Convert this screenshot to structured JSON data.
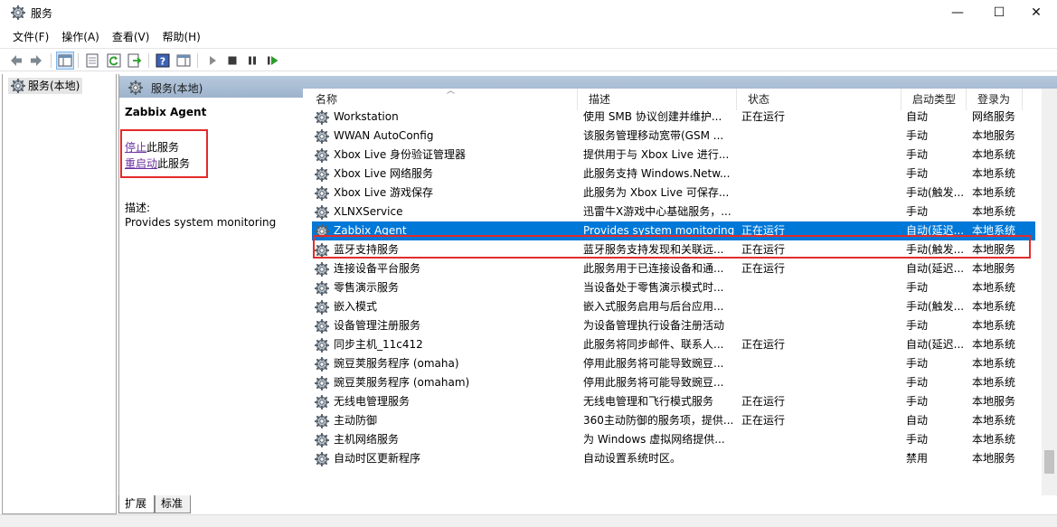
{
  "window": {
    "title": "服务",
    "minimize": "—",
    "maximize": "☐",
    "close": "✕"
  },
  "menu": [
    "文件(F)",
    "操作(A)",
    "查看(V)",
    "帮助(H)"
  ],
  "tree": {
    "root": "服务(本地)"
  },
  "pane": {
    "header": "服务(本地)"
  },
  "detail": {
    "service_name": "Zabbix Agent",
    "stop_link": "停止",
    "stop_suffix": "此服务",
    "restart_link": "重启动",
    "restart_suffix": "此服务",
    "desc_label": "描述:",
    "desc_text": "Provides system monitoring"
  },
  "columns": {
    "name": "名称",
    "desc": "描述",
    "status": "状态",
    "startup": "启动类型",
    "logon": "登录为"
  },
  "rows": [
    {
      "name": "Workstation",
      "desc": "使用 SMB 协议创建并维护...",
      "status": "正在运行",
      "startup": "自动",
      "logon": "网络服务"
    },
    {
      "name": "WWAN AutoConfig",
      "desc": "该服务管理移动宽带(GSM ...",
      "status": "",
      "startup": "手动",
      "logon": "本地服务"
    },
    {
      "name": "Xbox Live 身份验证管理器",
      "desc": "提供用于与 Xbox Live 进行...",
      "status": "",
      "startup": "手动",
      "logon": "本地系统"
    },
    {
      "name": "Xbox Live 网络服务",
      "desc": "此服务支持 Windows.Netw...",
      "status": "",
      "startup": "手动",
      "logon": "本地系统"
    },
    {
      "name": "Xbox Live 游戏保存",
      "desc": "此服务为 Xbox Live 可保存...",
      "status": "",
      "startup": "手动(触发...",
      "logon": "本地系统"
    },
    {
      "name": "XLNXService",
      "desc": "迅雷牛X游戏中心基础服务，...",
      "status": "",
      "startup": "手动",
      "logon": "本地系统"
    },
    {
      "name": "Zabbix Agent",
      "desc": "Provides system monitoring",
      "status": "正在运行",
      "startup": "自动(延迟...",
      "logon": "本地系统"
    },
    {
      "name": "蓝牙支持服务",
      "desc": "蓝牙服务支持发现和关联远...",
      "status": "正在运行",
      "startup": "手动(触发...",
      "logon": "本地服务"
    },
    {
      "name": "连接设备平台服务",
      "desc": "此服务用于已连接设备和通...",
      "status": "正在运行",
      "startup": "自动(延迟...",
      "logon": "本地服务"
    },
    {
      "name": "零售演示服务",
      "desc": "当设备处于零售演示模式时...",
      "status": "",
      "startup": "手动",
      "logon": "本地系统"
    },
    {
      "name": "嵌入模式",
      "desc": "嵌入式服务启用与后台应用...",
      "status": "",
      "startup": "手动(触发...",
      "logon": "本地系统"
    },
    {
      "name": "设备管理注册服务",
      "desc": "为设备管理执行设备注册活动",
      "status": "",
      "startup": "手动",
      "logon": "本地系统"
    },
    {
      "name": "同步主机_11c412",
      "desc": "此服务将同步邮件、联系人...",
      "status": "正在运行",
      "startup": "自动(延迟...",
      "logon": "本地系统"
    },
    {
      "name": "豌豆荚服务程序 (omaha)",
      "desc": "停用此服务将可能导致豌豆...",
      "status": "",
      "startup": "手动",
      "logon": "本地系统"
    },
    {
      "name": "豌豆荚服务程序 (omaham)",
      "desc": "停用此服务将可能导致豌豆...",
      "status": "",
      "startup": "手动",
      "logon": "本地系统"
    },
    {
      "name": "无线电管理服务",
      "desc": "无线电管理和飞行模式服务",
      "status": "正在运行",
      "startup": "手动",
      "logon": "本地服务"
    },
    {
      "name": "主动防御",
      "desc": "360主动防御的服务项，提供...",
      "status": "正在运行",
      "startup": "自动",
      "logon": "本地系统"
    },
    {
      "name": "主机网络服务",
      "desc": "为 Windows 虚拟网络提供...",
      "status": "",
      "startup": "手动",
      "logon": "本地系统"
    },
    {
      "name": "自动时区更新程序",
      "desc": "自动设置系统时区。",
      "status": "",
      "startup": "禁用",
      "logon": "本地服务"
    }
  ],
  "selected_row": 6,
  "tabs": [
    "扩展",
    "标准"
  ],
  "colors": {
    "selection": "#0078d7",
    "highlight_box": "#e32b2b",
    "link": "#6b2fa0"
  }
}
